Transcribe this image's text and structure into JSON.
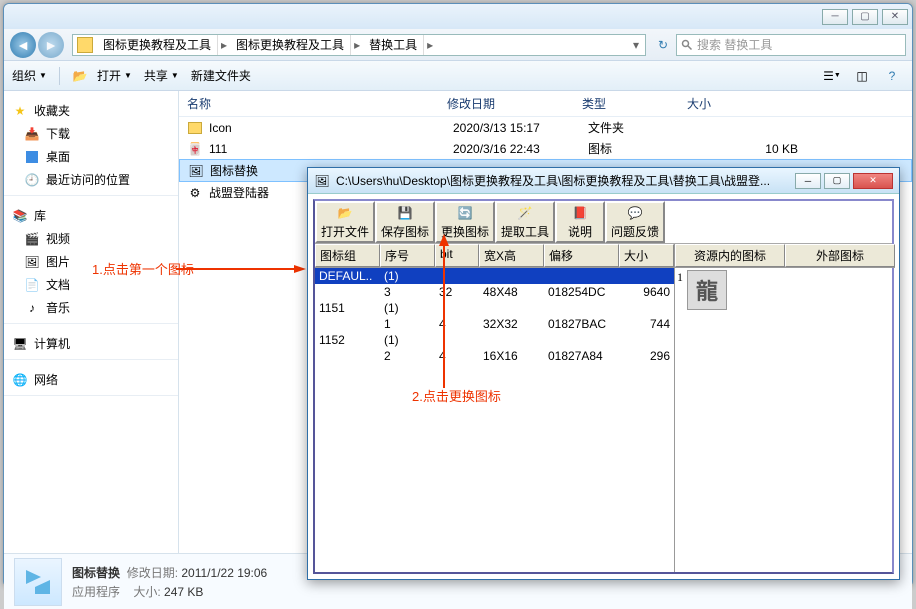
{
  "explorer": {
    "breadcrumbs": [
      "图标更换教程及工具",
      "图标更换教程及工具",
      "替换工具"
    ],
    "search_placeholder": "搜索 替换工具",
    "toolbar": {
      "organize": "组织",
      "open": "打开",
      "share": "共享",
      "new_folder": "新建文件夹"
    },
    "sidebar": {
      "favorites": "收藏夹",
      "downloads": "下载",
      "desktop": "桌面",
      "recent": "最近访问的位置",
      "libraries": "库",
      "videos": "视频",
      "pictures": "图片",
      "documents": "文档",
      "music": "音乐",
      "computer": "计算机",
      "network": "网络"
    },
    "columns": {
      "name": "名称",
      "date": "修改日期",
      "type": "类型",
      "size": "大小"
    },
    "rows": [
      {
        "name": "Icon",
        "date": "2020/3/13 15:17",
        "type": "文件夹",
        "size": ""
      },
      {
        "name": "111",
        "date": "2020/3/16 22:43",
        "type": "图标",
        "size": "10 KB"
      },
      {
        "name": "图标替换",
        "date": "",
        "type": "",
        "size": ""
      },
      {
        "name": "战盟登陆器",
        "date": "",
        "type": "",
        "size": ""
      }
    ],
    "status": {
      "name": "图标替换",
      "date_label": "修改日期:",
      "date": "2011/1/22 19:06",
      "type": "应用程序",
      "size_label": "大小:",
      "size": "247 KB"
    }
  },
  "tool": {
    "title": "C:\\Users\\hu\\Desktop\\图标更换教程及工具\\图标更换教程及工具\\替换工具\\战盟登...",
    "buttons": {
      "open": "打开文件",
      "save": "保存图标",
      "replace": "更换图标",
      "extract": "提取工具",
      "help": "说明",
      "feedback": "问题反馈"
    },
    "grid_head": [
      "图标组",
      "序号",
      "bit",
      "宽X高",
      "偏移",
      "大小"
    ],
    "grid_rows": [
      {
        "c1": "DEFAUL..",
        "c2": "(1)",
        "c3": "",
        "c4": "",
        "c5": "",
        "c6": "",
        "sel": true
      },
      {
        "c1": "",
        "c2": "3",
        "c3": "32",
        "c4": "48X48",
        "c5": "018254DC",
        "c6": "9640"
      },
      {
        "c1": "1151",
        "c2": "(1)",
        "c3": "",
        "c4": "",
        "c5": "",
        "c6": ""
      },
      {
        "c1": "",
        "c2": "1",
        "c3": "4",
        "c4": "32X32",
        "c5": "01827BAC",
        "c6": "744"
      },
      {
        "c1": "1152",
        "c2": "(1)",
        "c3": "",
        "c4": "",
        "c5": "",
        "c6": ""
      },
      {
        "c1": "",
        "c2": "2",
        "c3": "4",
        "c4": "16X16",
        "c5": "01827A84",
        "c6": "296"
      }
    ],
    "right_head": [
      "资源内的图标",
      "外部图标"
    ],
    "res_index": "1",
    "res_char": "龍"
  },
  "annotations": {
    "a1": "1.点击第一个图标",
    "a2": "2.点击更换图标"
  }
}
